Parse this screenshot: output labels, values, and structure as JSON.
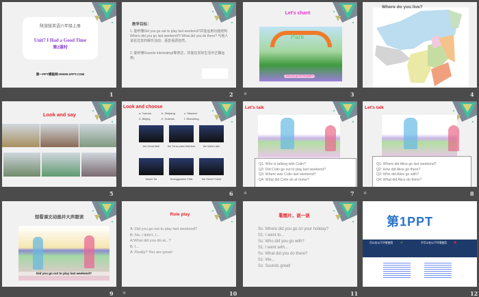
{
  "slides": [
    {
      "number": "1",
      "subtitle": "陕旅版英语六年级上册",
      "title": "Unit7 I Had a Good Time",
      "lesson": "第2课时",
      "footer": "第一PPT模板网-WWW.1PPT.COM"
    },
    {
      "number": "2",
      "heading": "教学目标：",
      "lines": [
        "1. 能听懂Did you go out to play last weekend?并能运用功能结构Where did you go last weekend?/ What did you do there? 与他人谈论过去的娱乐活动，语音语调自然。",
        "2. 能听懂Sounds interesting!等表达，并能在实际生活中正确运用。"
      ]
    },
    {
      "number": "3",
      "title": "Let's chant",
      "sign": "Park",
      "caption": "Did you go to the park?"
    },
    {
      "number": "4",
      "title": "Where do you live?"
    },
    {
      "number": "5",
      "title": "Look and say"
    },
    {
      "number": "6",
      "title": "Look and choose",
      "options": [
        "a. Yunnan",
        "b. Zhejiang",
        "c. Shaanxi",
        "d. Beijing",
        "e. Guizhou",
        "f. Shandong"
      ],
      "captions": [
        "the Great Wall",
        "the Terra-cotta Warriors",
        "the West Lake",
        "Mount Tai",
        "Huangguoshu Falls",
        "the Stone Forest"
      ]
    },
    {
      "number": "7",
      "title": "Let's talk",
      "questions": [
        "Q1: Who is talking with Colin?",
        "Q2: Did Colin go out to play last weekend?",
        "Q3: Where was Colin last weekend?",
        "Q4: What did Colin do at home?"
      ]
    },
    {
      "number": "8",
      "title": "Let's talk",
      "questions": [
        "Q1: Where did Alice go last weekend?",
        "Q2: How did Alice go there?",
        "Q3: Who did Alice go with?",
        "Q4: What did Alice do there?"
      ]
    },
    {
      "number": "9",
      "title": "观看课文动画并大声跟读",
      "caption": "Did you go out to play last weekend?"
    },
    {
      "number": "10",
      "title": "Role play",
      "lines": [
        "A: Did you go out to play last weekend?",
        "B: No, I didn't. I...",
        "A:What did you do at...?",
        "B: I...",
        "A: Really? You are great!"
      ]
    },
    {
      "number": "11",
      "title": "看图片，说一说",
      "lines": [
        "Ss: Where did you go on your holiday?",
        "S1: I went to...",
        "Ss: Who did you go with?",
        "S1: I went with...",
        "Ss: What did you do there?",
        "S1: We...",
        "Ss: Sounds great!"
      ]
    },
    {
      "number": "12",
      "logo": "第1PPT",
      "left_heading": "可以在以下环境使用",
      "right_heading": "不可以在以下环境使用"
    }
  ],
  "colors": {
    "background": "#4b4b4b",
    "slide": "#f1f1f1",
    "title_red": "#e8202a",
    "title_purple": "#8a3fd1",
    "banner": "#1e3a6b"
  }
}
